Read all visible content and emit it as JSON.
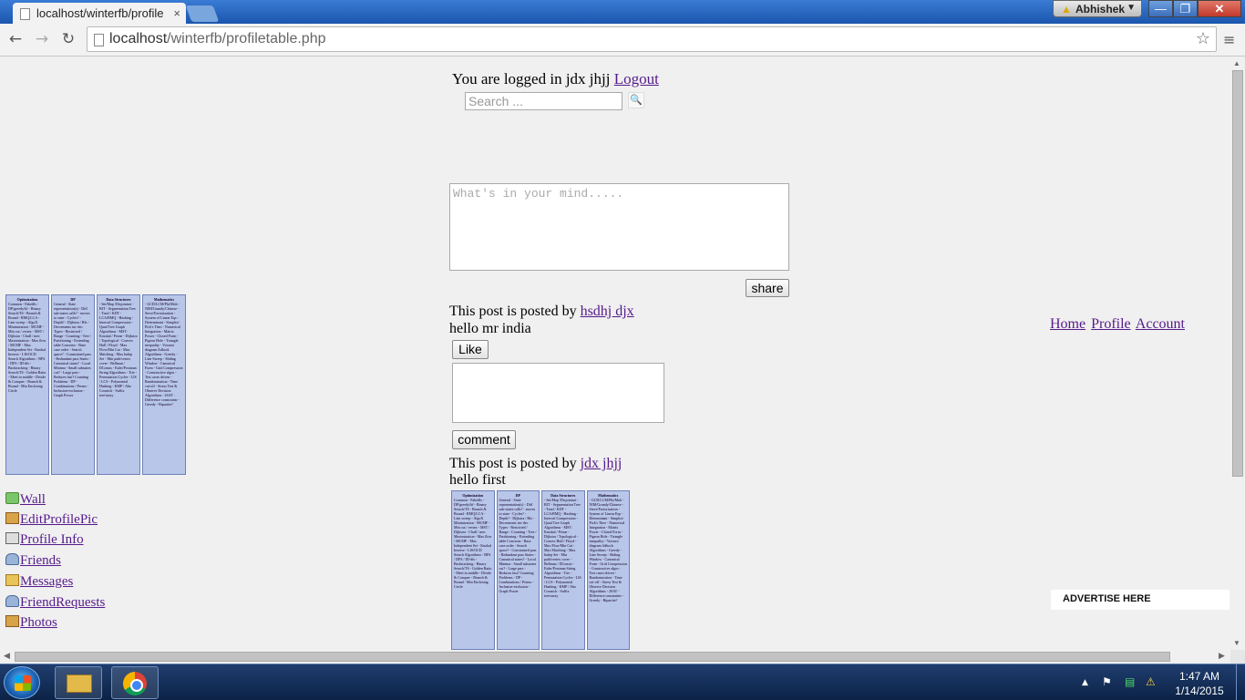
{
  "browser": {
    "tab_title": "localhost/winterfb/profile",
    "tab_close": "×",
    "user_label": "Abhishek",
    "min_glyph": "—",
    "max_glyph": "❐",
    "close_glyph": "✕",
    "url_host": "localhost",
    "url_path": "/winterfb/profiletable.php",
    "back": "←",
    "forward": "→",
    "reload": "↻",
    "star": "☆",
    "menu": "≡"
  },
  "header": {
    "logged_in_text": "You are logged in jdx jhjj",
    "logout_label": "Logout",
    "search_placeholder": "Search ...",
    "search_icon": "🔍"
  },
  "composer": {
    "placeholder": "What's in your mind.....",
    "share_label": "share"
  },
  "posts": [
    {
      "posted_by_prefix": "This post is posted by",
      "author": "hsdhj djx ",
      "text": "hello mr india",
      "like_label": "Like",
      "comment_label": "comment"
    },
    {
      "posted_by_prefix": "This post is posted by",
      "author": "jdx jhjj ",
      "text": "hello first"
    }
  ],
  "sidebar": {
    "items": [
      {
        "label": "Wall",
        "icon": "wall-icon"
      },
      {
        "label": "EditProfilePic",
        "icon": "picture-icon"
      },
      {
        "label": "Profile Info",
        "icon": "info-icon"
      },
      {
        "label": "Friends",
        "icon": "friends-icon"
      },
      {
        "label": "Messages",
        "icon": "messages-icon"
      },
      {
        "label": "FriendRequests",
        "icon": "friends-icon"
      },
      {
        "label": "Photos",
        "icon": "picture-icon"
      }
    ]
  },
  "right_nav": {
    "home": "Home",
    "profile": "Profile",
    "account": "Account"
  },
  "advert": "ADVERTISE HERE",
  "cheatsheet": {
    "columns": [
      {
        "head": "Optimization",
        "body": "Common - Fakeills - DP/greedy/bf - Binary Search/TS - Branch & Bound - RMQ/LCA - Line sweep - AlgoX Minimization - MCMF - Min cut / vertex - MST / Dijkstra - Chull / mec Maximization - Max flow / MCMF - Max Independent Set - Knokal Inverse - LIS/OCD Search Algorithms - BFS / DFS / ID-dfs - Backtracking - Binary Search/TS - Golden Ratio - Meet in middle - Divide & Conquer - Branch & Bound - Min Enclosing Circle"
      },
      {
        "head": "DP",
        "body": "General - State representation(s) - Diff sub-states calls? - moves to state - Cycles? - Depth? - Dijkstra / Bfs - Decrements inc-dec Types - Restricted / Range - Counting - Tree / Partitioning - Extending table Concerns - Base case order - Search space? - Constrained pars - Redundant pars States - Canonical states? - Local Minima - Small substates cut? - Large pars - Reduces fast? Counting Problems - DP - Combinations / Perms - Inclusion-exclusion - Graph Power"
      },
      {
        "head": "Data Structures",
        "body": "- Set/Map /Disjointset - BIT - Segmentation Tree - Treaf / KDT - LCA/RMQ - Hashing - Interval Compression - Quad Tree Graph Algorithms - MST: Kruskal / Prime - Dijkstra / Topological - Convex Hull / Floyd - Max Flow/Min Cut - Max Matching - Max Indep Set - Min path/vertex cover - Bellman / DConsts - Euler/Postman String Algorithms - Trie - Permutation Cycles - LIS / LCS - Polynomial Hashing - KMP / Aho Corasick - Suffix tree/array"
      },
      {
        "head": "Mathematics",
        "body": "- GCD/LCM/Phi/Mob - NIM/Grundy/Chinese - Sieve/Factorization - System of Linear Eqs - Determinant - Simplex/ Pick's Theo - Numerical Integration - Matrix Power - Closed Form - Pigeon Hole - Triangle inequality - Voronoi diagram Adhock Algorithms - Greedy - Line Sweep - Sliding Window - Canonical Form - Grid Compression - Constructive algos - Test cases driven - Randomization - Time cut-off - Stress Test & Observe Decision Algorithms - 2SAT - Difference constraints - Greedy - Bipartite?"
      }
    ]
  },
  "taskbar": {
    "time": "1:47 AM",
    "date": "1/14/2015",
    "tray_up": "▲",
    "tray_flag": "⚑",
    "tray_net": "▤",
    "tray_power": "⚠"
  }
}
